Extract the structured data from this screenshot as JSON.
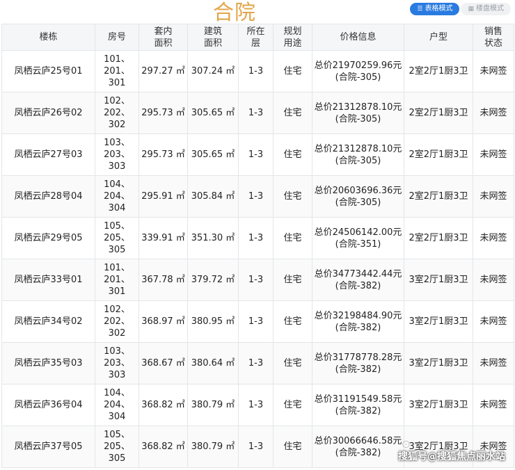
{
  "page": {
    "title": "合院"
  },
  "modes": {
    "table": {
      "label": "表格模式",
      "icon": "list-icon"
    },
    "plan": {
      "label": "楼盘模式",
      "icon": "grid-icon"
    }
  },
  "table": {
    "headers": [
      "楼栋",
      "房号",
      "套内\n面积",
      "建筑\n面积",
      "所在\n层",
      "规划\n用途",
      "价格信息",
      "户型",
      "销售\n状态"
    ],
    "rows": [
      {
        "building": "凤栖云庐25号01",
        "rooms": "101、\n201、301",
        "inner_area": "297.27 ㎡",
        "gross_area": "307.24 ㎡",
        "floors": "1-3",
        "usage": "住宅",
        "price": "总价21970259.96元(合院-305)",
        "layout": "2室2厅1厨3卫",
        "status": "未网签"
      },
      {
        "building": "凤栖云庐26号02",
        "rooms": "102、\n202、302",
        "inner_area": "295.73 ㎡",
        "gross_area": "305.65 ㎡",
        "floors": "1-3",
        "usage": "住宅",
        "price": "总价21312878.10元(合院-305)",
        "layout": "2室2厅1厨3卫",
        "status": "未网签"
      },
      {
        "building": "凤栖云庐27号03",
        "rooms": "103、\n203、303",
        "inner_area": "295.73 ㎡",
        "gross_area": "305.65 ㎡",
        "floors": "1-3",
        "usage": "住宅",
        "price": "总价21312878.10元(合院-305)",
        "layout": "2室2厅1厨3卫",
        "status": "未网签"
      },
      {
        "building": "凤栖云庐28号04",
        "rooms": "104、\n204、304",
        "inner_area": "295.91 ㎡",
        "gross_area": "305.84 ㎡",
        "floors": "1-3",
        "usage": "住宅",
        "price": "总价20603696.36元(合院-305)",
        "layout": "2室2厅1厨3卫",
        "status": "未网签"
      },
      {
        "building": "凤栖云庐29号05",
        "rooms": "105、\n205、305",
        "inner_area": "339.91 ㎡",
        "gross_area": "351.30 ㎡",
        "floors": "1-3",
        "usage": "住宅",
        "price": "总价24506142.00元(合院-351)",
        "layout": "2室2厅1厨3卫",
        "status": "未网签"
      },
      {
        "building": "凤栖云庐33号01",
        "rooms": "101、\n201、301",
        "inner_area": "367.78 ㎡",
        "gross_area": "379.72 ㎡",
        "floors": "1-3",
        "usage": "住宅",
        "price": "总价34773442.44元(合院-382)",
        "layout": "3室2厅1厨3卫",
        "status": "未网签"
      },
      {
        "building": "凤栖云庐34号02",
        "rooms": "102、\n202、302",
        "inner_area": "368.97 ㎡",
        "gross_area": "380.95 ㎡",
        "floors": "1-3",
        "usage": "住宅",
        "price": "总价32198484.90元(合院-382)",
        "layout": "3室2厅1厨3卫",
        "status": "未网签"
      },
      {
        "building": "凤栖云庐35号03",
        "rooms": "103、\n203、303",
        "inner_area": "368.67 ㎡",
        "gross_area": "380.64 ㎡",
        "floors": "1-3",
        "usage": "住宅",
        "price": "总价31778778.28元(合院-382)",
        "layout": "3室2厅1厨3卫",
        "status": "未网签"
      },
      {
        "building": "凤栖云庐36号04",
        "rooms": "104、\n204、304",
        "inner_area": "368.82 ㎡",
        "gross_area": "380.79 ㎡",
        "floors": "1-3",
        "usage": "住宅",
        "price": "总价31191549.58元(合院-382)",
        "layout": "3室2厅1厨3卫",
        "status": "未网签"
      },
      {
        "building": "凤栖云庐37号05",
        "rooms": "105、\n205、305",
        "inner_area": "368.82 ㎡",
        "gross_area": "380.79 ㎡",
        "floors": "1-3",
        "usage": "住宅",
        "price": "总价30066646.58元(合院-382)",
        "layout": "3室2厅1厨3卫",
        "status": "未网签"
      }
    ]
  },
  "watermark": {
    "text": "搜狐号@搜狐焦点丽水站"
  },
  "colors": {
    "title": "#e2a64a",
    "accent": "#2a7be0"
  }
}
